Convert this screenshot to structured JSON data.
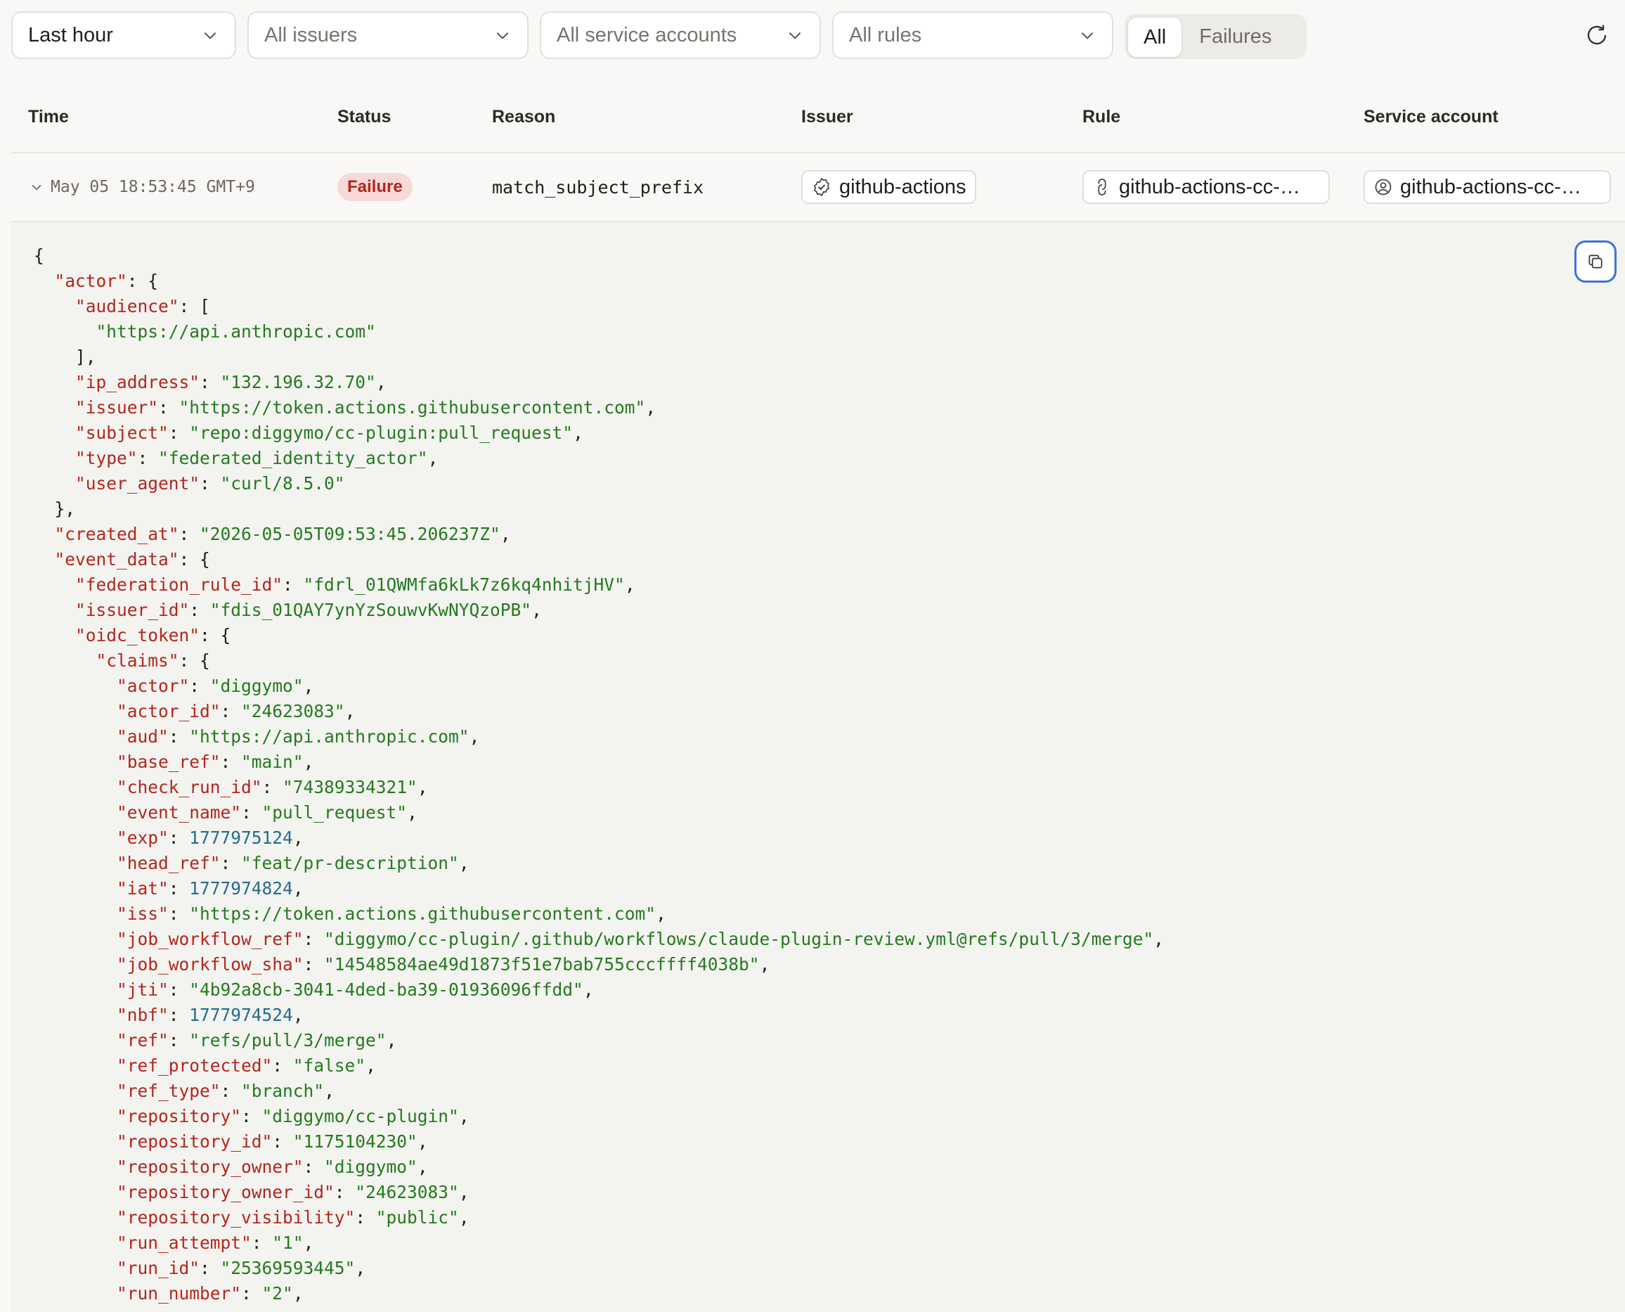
{
  "filters": {
    "time_range": "Last hour",
    "issuers": "All issuers",
    "service_accounts": "All service accounts",
    "rules": "All rules",
    "segment": {
      "all": "All",
      "failures": "Failures",
      "active": "All"
    }
  },
  "table": {
    "headers": {
      "time": "Time",
      "status": "Status",
      "reason": "Reason",
      "issuer": "Issuer",
      "rule": "Rule",
      "service_account": "Service account"
    },
    "row": {
      "time": "May 05 18:53:45 GMT+9",
      "status": "Failure",
      "reason": "match_subject_prefix",
      "issuer": "github-actions",
      "rule": "github-actions-cc-…",
      "service_account": "github-actions-cc-…"
    }
  },
  "detail": {
    "lines": [
      [
        [
          "p",
          "{"
        ]
      ],
      [
        [
          "p",
          "  "
        ],
        [
          "k",
          "\"actor\""
        ],
        [
          "p",
          ": {"
        ]
      ],
      [
        [
          "p",
          "    "
        ],
        [
          "k",
          "\"audience\""
        ],
        [
          "p",
          ": ["
        ]
      ],
      [
        [
          "p",
          "      "
        ],
        [
          "s",
          "\"https://api.anthropic.com\""
        ]
      ],
      [
        [
          "p",
          "    ],"
        ]
      ],
      [
        [
          "p",
          "    "
        ],
        [
          "k",
          "\"ip_address\""
        ],
        [
          "p",
          ": "
        ],
        [
          "s",
          "\"132.196.32.70\""
        ],
        [
          "p",
          ","
        ]
      ],
      [
        [
          "p",
          "    "
        ],
        [
          "k",
          "\"issuer\""
        ],
        [
          "p",
          ": "
        ],
        [
          "s",
          "\"https://token.actions.githubusercontent.com\""
        ],
        [
          "p",
          ","
        ]
      ],
      [
        [
          "p",
          "    "
        ],
        [
          "k",
          "\"subject\""
        ],
        [
          "p",
          ": "
        ],
        [
          "s",
          "\"repo:diggymo/cc-plugin:pull_request\""
        ],
        [
          "p",
          ","
        ]
      ],
      [
        [
          "p",
          "    "
        ],
        [
          "k",
          "\"type\""
        ],
        [
          "p",
          ": "
        ],
        [
          "s",
          "\"federated_identity_actor\""
        ],
        [
          "p",
          ","
        ]
      ],
      [
        [
          "p",
          "    "
        ],
        [
          "k",
          "\"user_agent\""
        ],
        [
          "p",
          ": "
        ],
        [
          "s",
          "\"curl/8.5.0\""
        ]
      ],
      [
        [
          "p",
          "  },"
        ]
      ],
      [
        [
          "p",
          "  "
        ],
        [
          "k",
          "\"created_at\""
        ],
        [
          "p",
          ": "
        ],
        [
          "s",
          "\"2026-05-05T09:53:45.206237Z\""
        ],
        [
          "p",
          ","
        ]
      ],
      [
        [
          "p",
          "  "
        ],
        [
          "k",
          "\"event_data\""
        ],
        [
          "p",
          ": {"
        ]
      ],
      [
        [
          "p",
          "    "
        ],
        [
          "k",
          "\"federation_rule_id\""
        ],
        [
          "p",
          ": "
        ],
        [
          "s",
          "\"fdrl_01QWMfa6kLk7z6kq4nhitjHV\""
        ],
        [
          "p",
          ","
        ]
      ],
      [
        [
          "p",
          "    "
        ],
        [
          "k",
          "\"issuer_id\""
        ],
        [
          "p",
          ": "
        ],
        [
          "s",
          "\"fdis_01QAY7ynYzSouwvKwNYQzoPB\""
        ],
        [
          "p",
          ","
        ]
      ],
      [
        [
          "p",
          "    "
        ],
        [
          "k",
          "\"oidc_token\""
        ],
        [
          "p",
          ": {"
        ]
      ],
      [
        [
          "p",
          "      "
        ],
        [
          "k",
          "\"claims\""
        ],
        [
          "p",
          ": {"
        ]
      ],
      [
        [
          "p",
          "        "
        ],
        [
          "k",
          "\"actor\""
        ],
        [
          "p",
          ": "
        ],
        [
          "s",
          "\"diggymo\""
        ],
        [
          "p",
          ","
        ]
      ],
      [
        [
          "p",
          "        "
        ],
        [
          "k",
          "\"actor_id\""
        ],
        [
          "p",
          ": "
        ],
        [
          "s",
          "\"24623083\""
        ],
        [
          "p",
          ","
        ]
      ],
      [
        [
          "p",
          "        "
        ],
        [
          "k",
          "\"aud\""
        ],
        [
          "p",
          ": "
        ],
        [
          "s",
          "\"https://api.anthropic.com\""
        ],
        [
          "p",
          ","
        ]
      ],
      [
        [
          "p",
          "        "
        ],
        [
          "k",
          "\"base_ref\""
        ],
        [
          "p",
          ": "
        ],
        [
          "s",
          "\"main\""
        ],
        [
          "p",
          ","
        ]
      ],
      [
        [
          "p",
          "        "
        ],
        [
          "k",
          "\"check_run_id\""
        ],
        [
          "p",
          ": "
        ],
        [
          "s",
          "\"74389334321\""
        ],
        [
          "p",
          ","
        ]
      ],
      [
        [
          "p",
          "        "
        ],
        [
          "k",
          "\"event_name\""
        ],
        [
          "p",
          ": "
        ],
        [
          "s",
          "\"pull_request\""
        ],
        [
          "p",
          ","
        ]
      ],
      [
        [
          "p",
          "        "
        ],
        [
          "k",
          "\"exp\""
        ],
        [
          "p",
          ": "
        ],
        [
          "n",
          "1777975124"
        ],
        [
          "p",
          ","
        ]
      ],
      [
        [
          "p",
          "        "
        ],
        [
          "k",
          "\"head_ref\""
        ],
        [
          "p",
          ": "
        ],
        [
          "s",
          "\"feat/pr-description\""
        ],
        [
          "p",
          ","
        ]
      ],
      [
        [
          "p",
          "        "
        ],
        [
          "k",
          "\"iat\""
        ],
        [
          "p",
          ": "
        ],
        [
          "n",
          "1777974824"
        ],
        [
          "p",
          ","
        ]
      ],
      [
        [
          "p",
          "        "
        ],
        [
          "k",
          "\"iss\""
        ],
        [
          "p",
          ": "
        ],
        [
          "s",
          "\"https://token.actions.githubusercontent.com\""
        ],
        [
          "p",
          ","
        ]
      ],
      [
        [
          "p",
          "        "
        ],
        [
          "k",
          "\"job_workflow_ref\""
        ],
        [
          "p",
          ": "
        ],
        [
          "s",
          "\"diggymo/cc-plugin/.github/workflows/claude-plugin-review.yml@refs/pull/3/merge\""
        ],
        [
          "p",
          ","
        ]
      ],
      [
        [
          "p",
          "        "
        ],
        [
          "k",
          "\"job_workflow_sha\""
        ],
        [
          "p",
          ": "
        ],
        [
          "s",
          "\"14548584ae49d1873f51e7bab755cccffff4038b\""
        ],
        [
          "p",
          ","
        ]
      ],
      [
        [
          "p",
          "        "
        ],
        [
          "k",
          "\"jti\""
        ],
        [
          "p",
          ": "
        ],
        [
          "s",
          "\"4b92a8cb-3041-4ded-ba39-01936096ffdd\""
        ],
        [
          "p",
          ","
        ]
      ],
      [
        [
          "p",
          "        "
        ],
        [
          "k",
          "\"nbf\""
        ],
        [
          "p",
          ": "
        ],
        [
          "n",
          "1777974524"
        ],
        [
          "p",
          ","
        ]
      ],
      [
        [
          "p",
          "        "
        ],
        [
          "k",
          "\"ref\""
        ],
        [
          "p",
          ": "
        ],
        [
          "s",
          "\"refs/pull/3/merge\""
        ],
        [
          "p",
          ","
        ]
      ],
      [
        [
          "p",
          "        "
        ],
        [
          "k",
          "\"ref_protected\""
        ],
        [
          "p",
          ": "
        ],
        [
          "s",
          "\"false\""
        ],
        [
          "p",
          ","
        ]
      ],
      [
        [
          "p",
          "        "
        ],
        [
          "k",
          "\"ref_type\""
        ],
        [
          "p",
          ": "
        ],
        [
          "s",
          "\"branch\""
        ],
        [
          "p",
          ","
        ]
      ],
      [
        [
          "p",
          "        "
        ],
        [
          "k",
          "\"repository\""
        ],
        [
          "p",
          ": "
        ],
        [
          "s",
          "\"diggymo/cc-plugin\""
        ],
        [
          "p",
          ","
        ]
      ],
      [
        [
          "p",
          "        "
        ],
        [
          "k",
          "\"repository_id\""
        ],
        [
          "p",
          ": "
        ],
        [
          "s",
          "\"1175104230\""
        ],
        [
          "p",
          ","
        ]
      ],
      [
        [
          "p",
          "        "
        ],
        [
          "k",
          "\"repository_owner\""
        ],
        [
          "p",
          ": "
        ],
        [
          "s",
          "\"diggymo\""
        ],
        [
          "p",
          ","
        ]
      ],
      [
        [
          "p",
          "        "
        ],
        [
          "k",
          "\"repository_owner_id\""
        ],
        [
          "p",
          ": "
        ],
        [
          "s",
          "\"24623083\""
        ],
        [
          "p",
          ","
        ]
      ],
      [
        [
          "p",
          "        "
        ],
        [
          "k",
          "\"repository_visibility\""
        ],
        [
          "p",
          ": "
        ],
        [
          "s",
          "\"public\""
        ],
        [
          "p",
          ","
        ]
      ],
      [
        [
          "p",
          "        "
        ],
        [
          "k",
          "\"run_attempt\""
        ],
        [
          "p",
          ": "
        ],
        [
          "s",
          "\"1\""
        ],
        [
          "p",
          ","
        ]
      ],
      [
        [
          "p",
          "        "
        ],
        [
          "k",
          "\"run_id\""
        ],
        [
          "p",
          ": "
        ],
        [
          "s",
          "\"25369593445\""
        ],
        [
          "p",
          ","
        ]
      ],
      [
        [
          "p",
          "        "
        ],
        [
          "k",
          "\"run_number\""
        ],
        [
          "p",
          ": "
        ],
        [
          "s",
          "\"2\""
        ],
        [
          "p",
          ","
        ]
      ]
    ]
  },
  "icons": {
    "chevron": "chevron-down-icon",
    "refresh": "refresh-icon",
    "expand": "chevron-down-icon",
    "issuer": "verified-badge-icon",
    "rule": "link-icon",
    "service_account": "user-circle-icon",
    "copy": "copy-icon"
  },
  "colors": {
    "json_key": "#b3261e",
    "json_string": "#247a1f",
    "json_number": "#256c8e",
    "failure_badge_bg": "#f7d9d7",
    "failure_badge_text": "#b3261e",
    "copy_button_border": "#3b74d6"
  }
}
